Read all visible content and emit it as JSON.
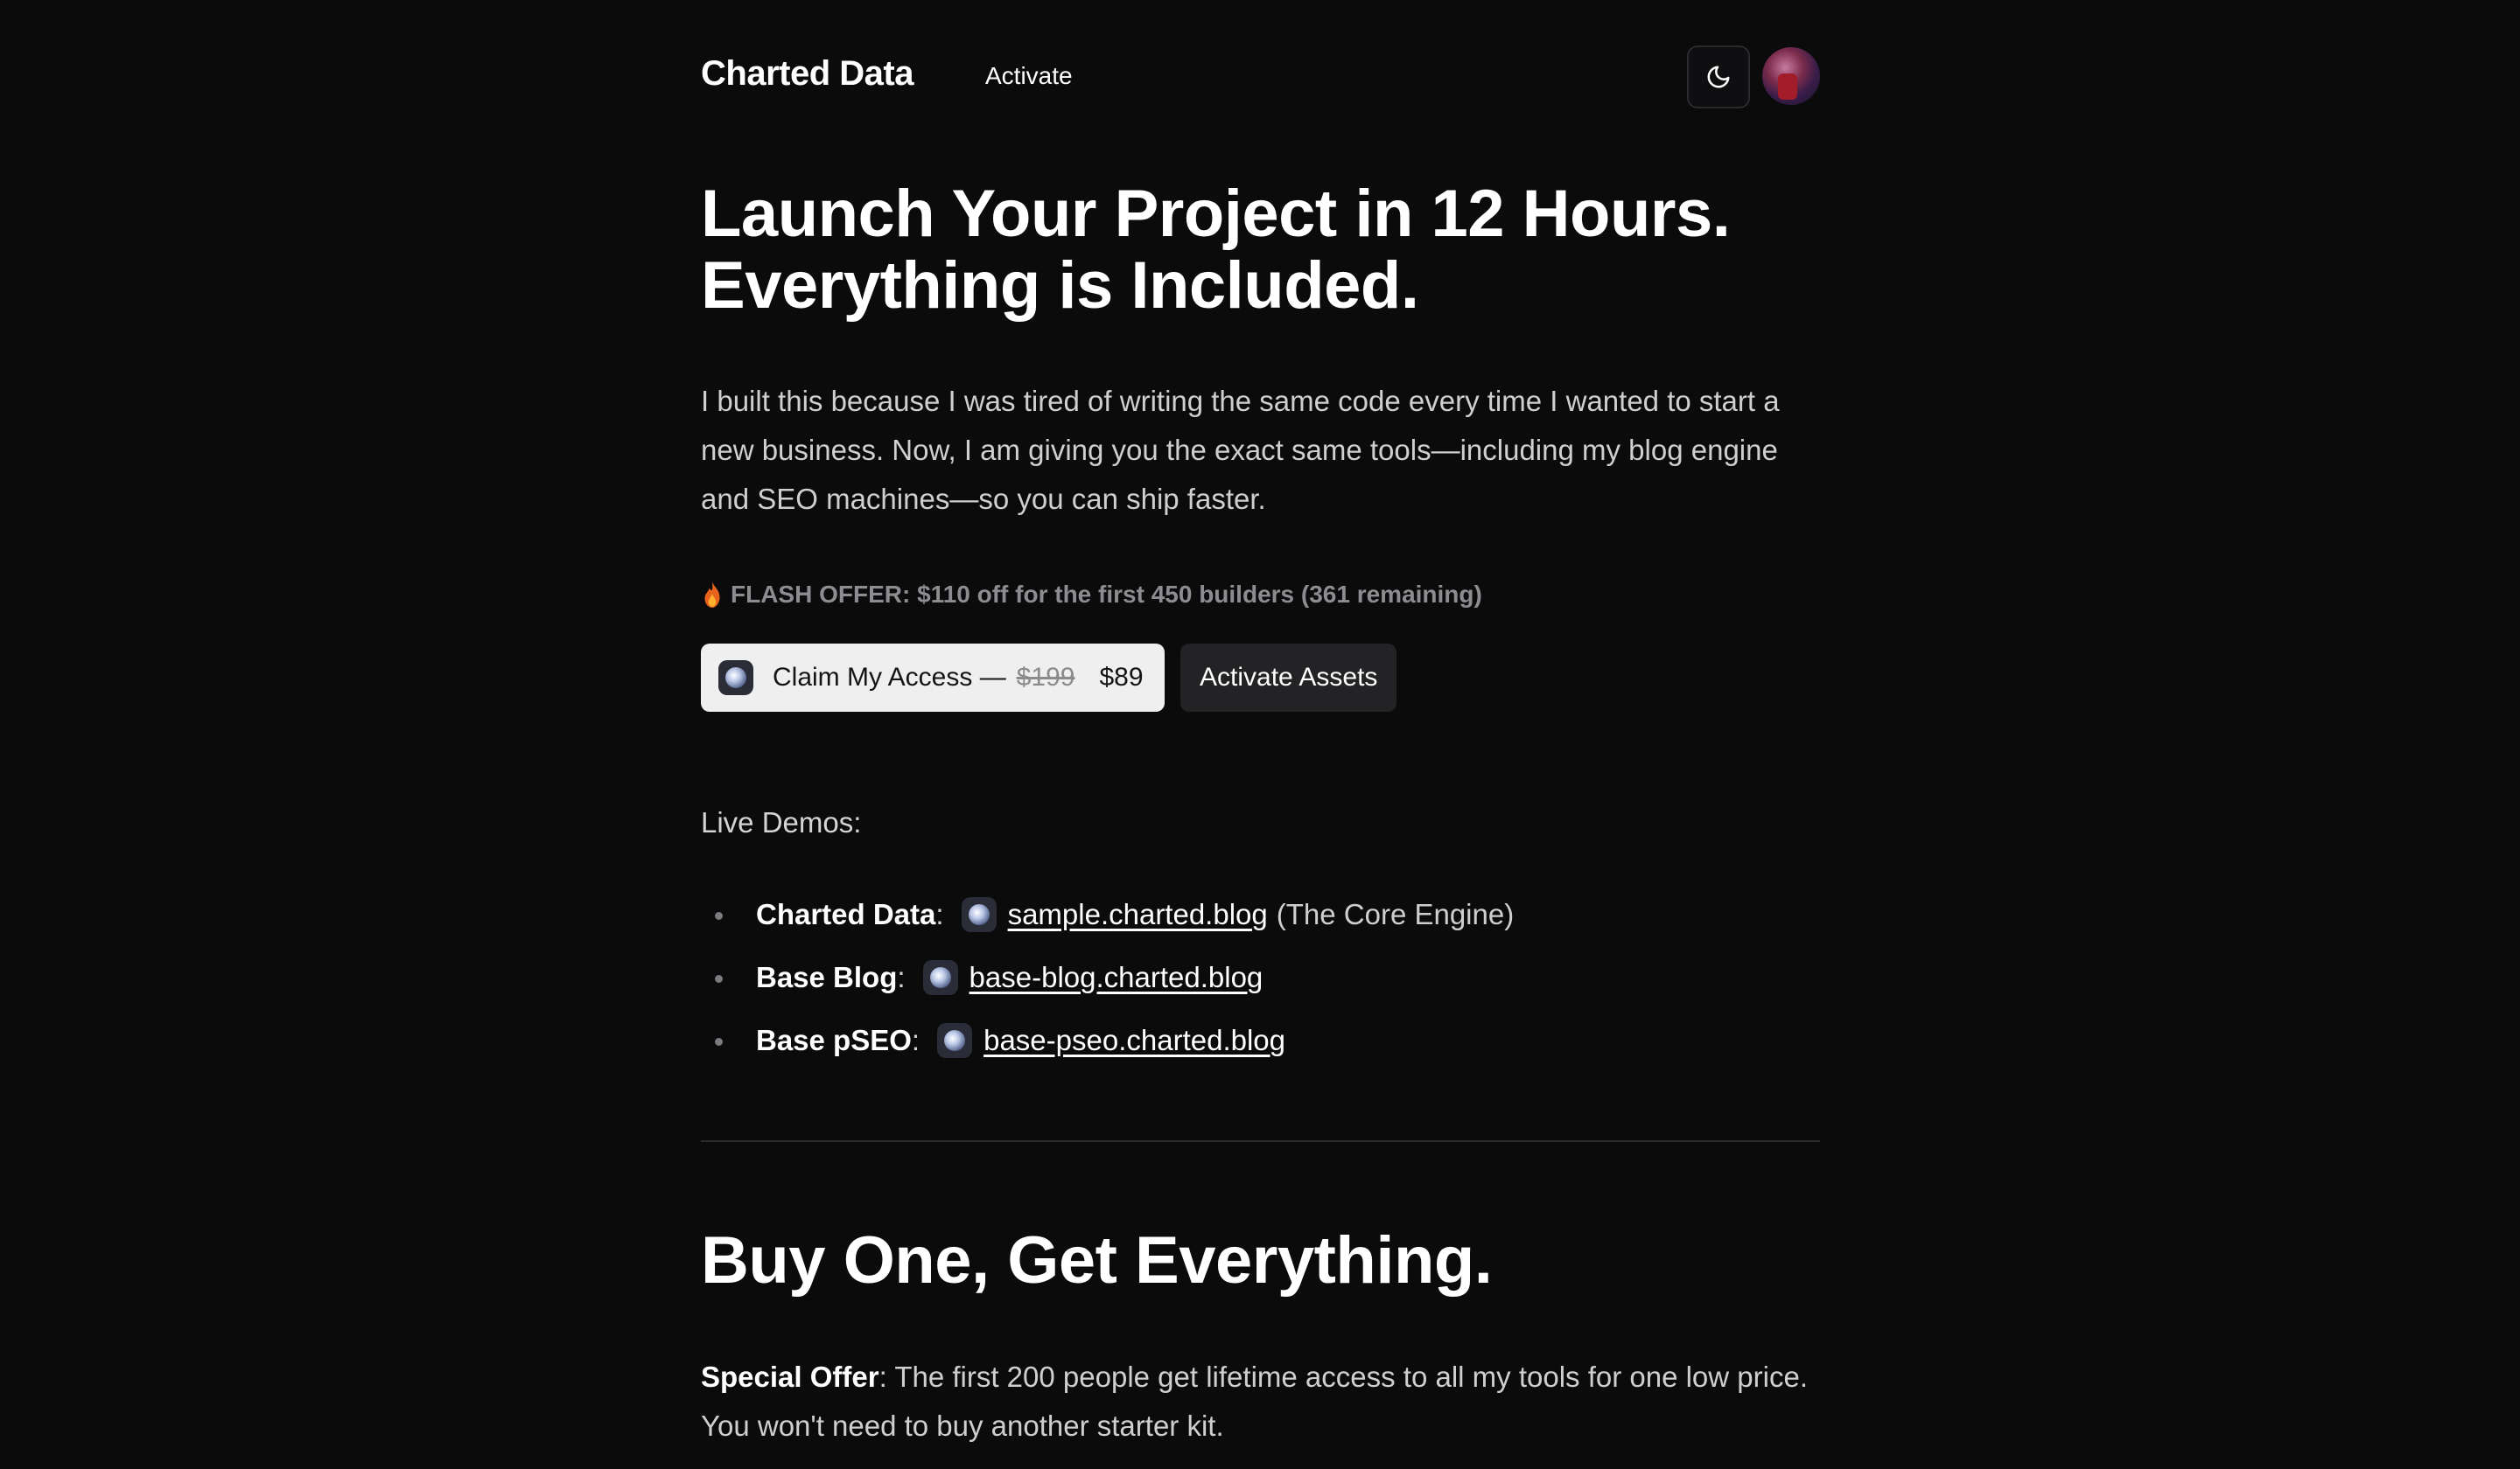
{
  "header": {
    "brand": "Charted Data",
    "nav_link": "Activate",
    "theme_icon": "moon-icon",
    "avatar": "user-avatar"
  },
  "hero": {
    "title_line1": "Launch Your Project in 12 Hours.",
    "title_line2": "Everything is Included.",
    "description": "I built this because I was tired of writing the same code every time I wanted to start a new business. Now, I am giving you the exact same tools—including my blog engine and SEO machines—so you can ship faster.",
    "flash_offer": "FLASH OFFER: $110 off for the first 450 builders (361 remaining)",
    "claim_button": {
      "label": "Claim My Access —",
      "old_price": "$199",
      "new_price": "$89"
    },
    "assets_button": "Activate Assets"
  },
  "demos": {
    "label": "Live Demos:",
    "items": [
      {
        "name": "Charted Data",
        "link": "sample.charted.blog",
        "note": "(The Core Engine)"
      },
      {
        "name": "Base Blog",
        "link": "base-blog.charted.blog",
        "note": ""
      },
      {
        "name": "Base pSEO",
        "link": "base-pseo.charted.blog",
        "note": ""
      }
    ]
  },
  "section": {
    "title": "Buy One, Get Everything.",
    "special_lead": "Special Offer",
    "special_text": "The first 200 people get lifetime access to all my tools for one low price. You won't need to buy another starter kit."
  },
  "colors": {
    "background": "#0b0b0c",
    "primary_button": "#efeff0",
    "secondary_button": "#232325",
    "muted_text": "#8d8d91"
  }
}
